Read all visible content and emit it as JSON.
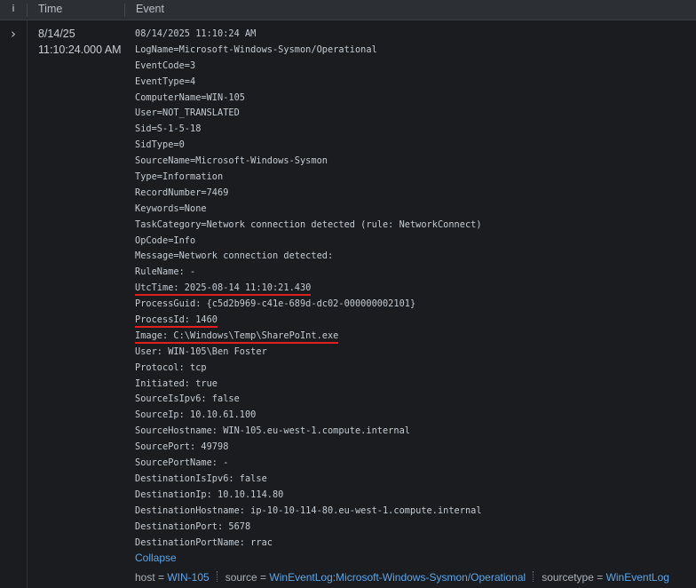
{
  "header": {
    "info_label": "i",
    "time_label": "Time",
    "event_label": "Event"
  },
  "row": {
    "time": {
      "date": "8/14/25",
      "clock": "11:10:24.000 AM"
    },
    "event_lines": [
      "08/14/2025 11:10:24 AM",
      "LogName=Microsoft-Windows-Sysmon/Operational",
      "EventCode=3",
      "EventType=4",
      "ComputerName=WIN-105",
      "User=NOT_TRANSLATED",
      "Sid=S-1-5-18",
      "SidType=0",
      "SourceName=Microsoft-Windows-Sysmon",
      "Type=Information",
      "RecordNumber=7469",
      "Keywords=None",
      "TaskCategory=Network connection detected (rule: NetworkConnect)",
      "OpCode=Info",
      "Message=Network connection detected:",
      "RuleName: -",
      "UtcTime: 2025-08-14 11:10:21.430",
      "ProcessGuid: {c5d2b969-c41e-689d-dc02-000000002101}",
      "ProcessId: 1460",
      "Image: C:\\Windows\\Temp\\SharePoInt.exe",
      "User: WIN-105\\Ben Foster",
      "Protocol: tcp",
      "Initiated: true",
      "SourceIsIpv6: false",
      "SourceIp: 10.10.61.100",
      "SourceHostname: WIN-105.eu-west-1.compute.internal",
      "SourcePort: 49798",
      "SourcePortName: -",
      "DestinationIsIpv6: false",
      "DestinationIp: 10.10.114.80",
      "DestinationHostname: ip-10-10-114-80.eu-west-1.compute.internal",
      "DestinationPort: 5678",
      "DestinationPortName: rrac"
    ],
    "highlighted_lines": [
      16,
      18,
      19
    ],
    "highlight_color": "#e01f1f",
    "collapse_label": "Collapse",
    "fields": [
      {
        "key": "host = ",
        "value": "WIN-105"
      },
      {
        "key": "source = ",
        "value": "WinEventLog:Microsoft-Windows-Sysmon/Operational"
      },
      {
        "key": "sourcetype = ",
        "value": "WinEventLog"
      }
    ]
  },
  "icons": {
    "expand": "chevron-right-icon",
    "info": "info-icon"
  },
  "colors": {
    "background": "#1b1c1f",
    "header": "#2c2f34",
    "link": "#5aa6ea"
  }
}
